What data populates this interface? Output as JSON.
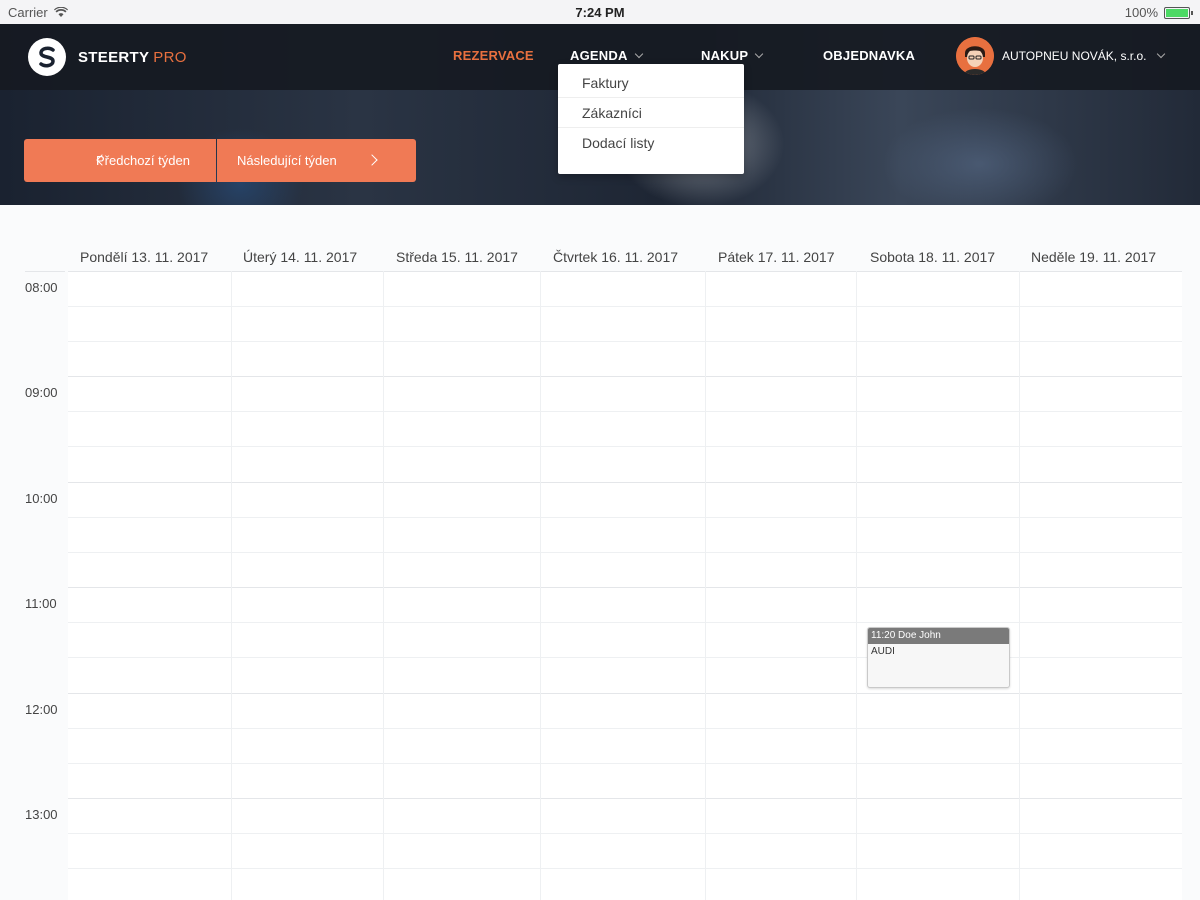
{
  "statusbar": {
    "carrier": "Carrier",
    "time": "7:24 PM",
    "battery": "100%"
  },
  "brand": {
    "name": "STEERTY",
    "suffix": "PRO",
    "accent": "#e8703f"
  },
  "nav": {
    "items": [
      {
        "label": "REZERVACE",
        "active": true
      },
      {
        "label": "AGENDA",
        "dropdown": true
      },
      {
        "label": "NAKUP",
        "dropdown": true
      },
      {
        "label": "OBJEDNAVKA"
      }
    ],
    "user": "AUTOPNEU NOVÁK, s.r.o."
  },
  "agenda_menu": [
    "Faktury",
    "Zákazníci",
    "Dodací listy"
  ],
  "week": {
    "prev_label": "Předchozí týden",
    "next_label": "Následující týden"
  },
  "days": [
    "Pondělí 13. 11. 2017",
    "Úterý 14. 11. 2017",
    "Středa 15. 11. 2017",
    "Čtvrtek 16. 11. 2017",
    "Pátek 17. 11. 2017",
    "Sobota 18. 11. 2017",
    "Neděle 19. 11. 2017"
  ],
  "hours": [
    "08:00",
    "09:00",
    "10:00",
    "11:00",
    "12:00",
    "13:00"
  ],
  "event": {
    "title": "11:20 Doe John",
    "detail": "AUDI"
  }
}
